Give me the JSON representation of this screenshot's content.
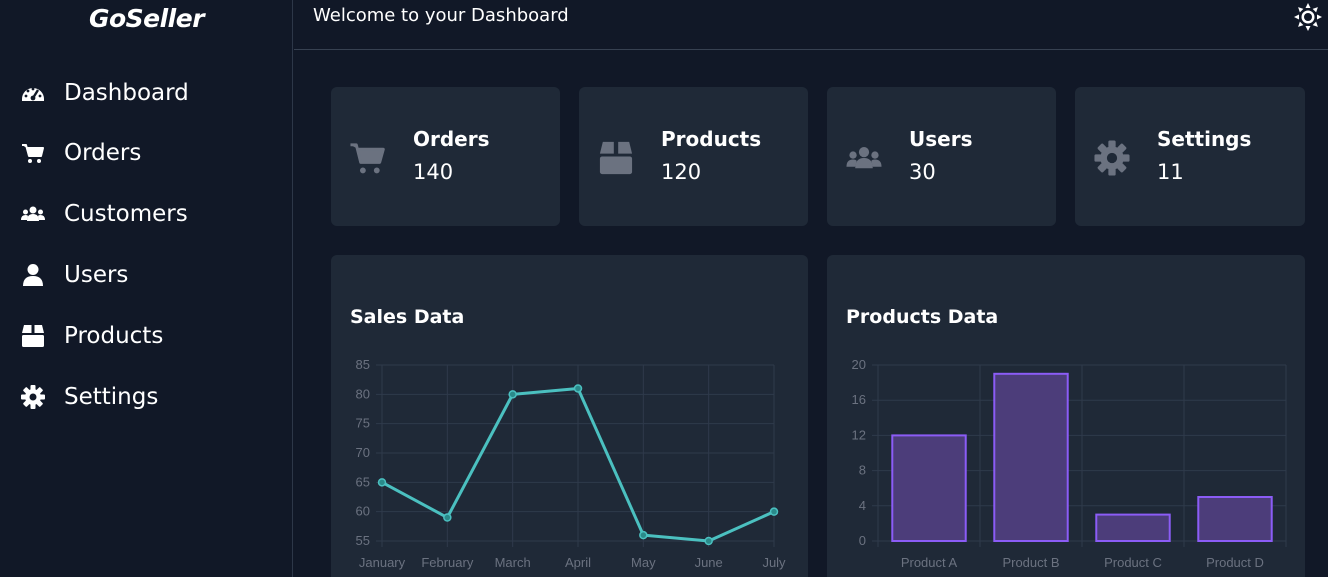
{
  "app": {
    "name": "GoSeller"
  },
  "header": {
    "title": "Welcome to your Dashboard",
    "theme_icon": "sun-icon"
  },
  "sidebar": {
    "items": [
      {
        "label": "Dashboard",
        "icon": "gauge-icon"
      },
      {
        "label": "Orders",
        "icon": "cart-icon"
      },
      {
        "label": "Customers",
        "icon": "users-icon"
      },
      {
        "label": "Users",
        "icon": "user-icon"
      },
      {
        "label": "Products",
        "icon": "box-icon"
      },
      {
        "label": "Settings",
        "icon": "gear-icon"
      }
    ]
  },
  "stats": [
    {
      "title": "Orders",
      "value": "140",
      "icon": "cart-icon"
    },
    {
      "title": "Products",
      "value": "120",
      "icon": "box-icon"
    },
    {
      "title": "Users",
      "value": "30",
      "icon": "users-icon"
    },
    {
      "title": "Settings",
      "value": "11",
      "icon": "gear-icon"
    }
  ],
  "colors": {
    "background": "#111827",
    "card": "#1f2937",
    "line": "#4bc0c0",
    "bar_fill": "#4c3d7a",
    "bar_stroke": "#8b5cf6",
    "icon_muted": "#6b7280"
  },
  "charts": {
    "sales": {
      "title": "Sales Data"
    },
    "products": {
      "title": "Products Data"
    }
  },
  "chart_data": [
    {
      "type": "line",
      "title": "Sales Data",
      "categories": [
        "January",
        "February",
        "March",
        "April",
        "May",
        "June",
        "July"
      ],
      "values": [
        65,
        59,
        80,
        81,
        56,
        55,
        60
      ],
      "ylim": [
        55,
        85
      ],
      "yticks": [
        55,
        60,
        65,
        70,
        75,
        80,
        85
      ],
      "grid": true
    },
    {
      "type": "bar",
      "title": "Products Data",
      "categories": [
        "Product A",
        "Product B",
        "Product C",
        "Product D"
      ],
      "values": [
        12,
        19,
        3,
        5
      ],
      "ylim": [
        0,
        20
      ],
      "yticks": [
        0,
        4,
        8,
        12,
        16,
        20
      ],
      "grid": true
    }
  ]
}
